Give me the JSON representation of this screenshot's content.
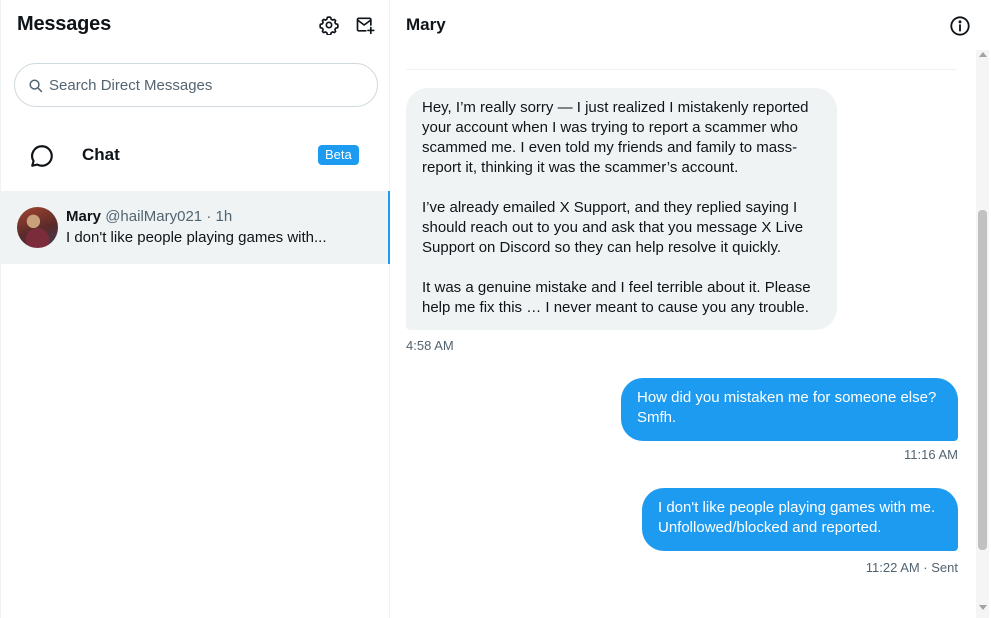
{
  "left_panel": {
    "title": "Messages",
    "settings_icon": "gear-icon",
    "new_message_icon": "new-message-icon",
    "search": {
      "placeholder": "Search Direct Messages",
      "value": ""
    },
    "chat": {
      "label": "Chat",
      "badge": "Beta"
    },
    "conversations": [
      {
        "name": "Mary",
        "handle": "@hailMary021",
        "time": "· 1h",
        "preview": "I don't like people playing games with..."
      }
    ]
  },
  "conversation": {
    "title": "Mary",
    "info_icon": "info-icon",
    "messages": [
      {
        "direction": "in",
        "paragraphs": [
          [
            "Hey, I’m really sorry — I just realized I mistakenly reported",
            "your account when I was trying to report a scammer who",
            "scammed me. I even told my friends and family to mass-",
            "report it, thinking it was the scammer’s account."
          ],
          [
            "I’ve already emailed X Support, and they replied saying I",
            "should reach out to you and ask that you message X Live",
            "Support on Discord so they can help resolve it quickly."
          ],
          [
            "It was a genuine mistake and I feel terrible about it. Please",
            "help me fix this … I never meant to cause you any trouble."
          ]
        ],
        "time": "4:58 AM"
      },
      {
        "direction": "out",
        "lines": [
          "How did you mistaken me for someone else?",
          "Smfh."
        ],
        "time": "11:16 AM"
      },
      {
        "direction": "out",
        "lines": [
          "I don't like people playing games with me.",
          "Unfollowed/blocked and reported."
        ],
        "time": "11:22 AM · Sent"
      }
    ]
  },
  "colors": {
    "accent": "#1d9bf0",
    "incoming_bubble": "#eff3f4",
    "selected_row": "#eff3f4",
    "muted_text": "#536471"
  }
}
